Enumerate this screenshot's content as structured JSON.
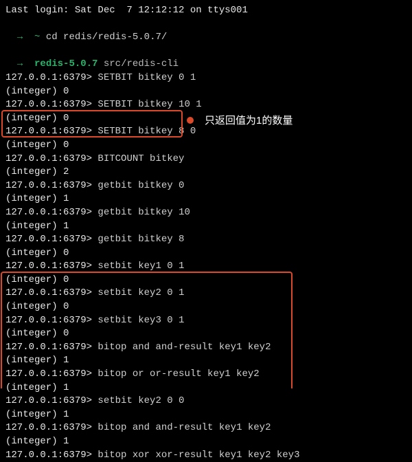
{
  "header": {
    "last_login": "Last login: Sat Dec  7 12:12:12 on ttys001"
  },
  "prompt1": {
    "arrow": "→",
    "tilde": "~",
    "cmd": "cd redis/redis-5.0.7/"
  },
  "prompt2": {
    "arrow": "→",
    "dir": "redis-5.0.7",
    "cmd": "src/redis-cli"
  },
  "redis_prompt": "127.0.0.1:6379>",
  "lines": [
    {
      "cmd": "SETBIT bitkey 0 1",
      "out": "(integer) 0"
    },
    {
      "cmd": "SETBIT bitkey 10 1",
      "out": "(integer) 0"
    },
    {
      "cmd": "SETBIT bitkey 8 0",
      "out": "(integer) 0"
    },
    {
      "cmd": "BITCOUNT bitkey",
      "out": "(integer) 2"
    },
    {
      "cmd": "getbit bitkey 0",
      "out": "(integer) 1"
    },
    {
      "cmd": "getbit bitkey 10",
      "out": "(integer) 1"
    },
    {
      "cmd": "getbit bitkey 8",
      "out": "(integer) 0"
    },
    {
      "cmd": "setbit key1 0 1",
      "out": "(integer) 0"
    },
    {
      "cmd": "setbit key2 0 1",
      "out": "(integer) 0"
    },
    {
      "cmd": "setbit key3 0 1",
      "out": "(integer) 0"
    },
    {
      "cmd": "bitop and and-result key1 key2",
      "out": "(integer) 1"
    },
    {
      "cmd": "bitop or or-result key1 key2",
      "out": "(integer) 1"
    },
    {
      "cmd": "setbit key2 0 0",
      "out": "(integer) 1"
    },
    {
      "cmd": "bitop and and-result key1 key2",
      "out": "(integer) 1"
    },
    {
      "cmd": "bitop xor xor-result key1 key2 key3",
      "out": ""
    }
  ],
  "annotation": "只返回值为1的数量"
}
